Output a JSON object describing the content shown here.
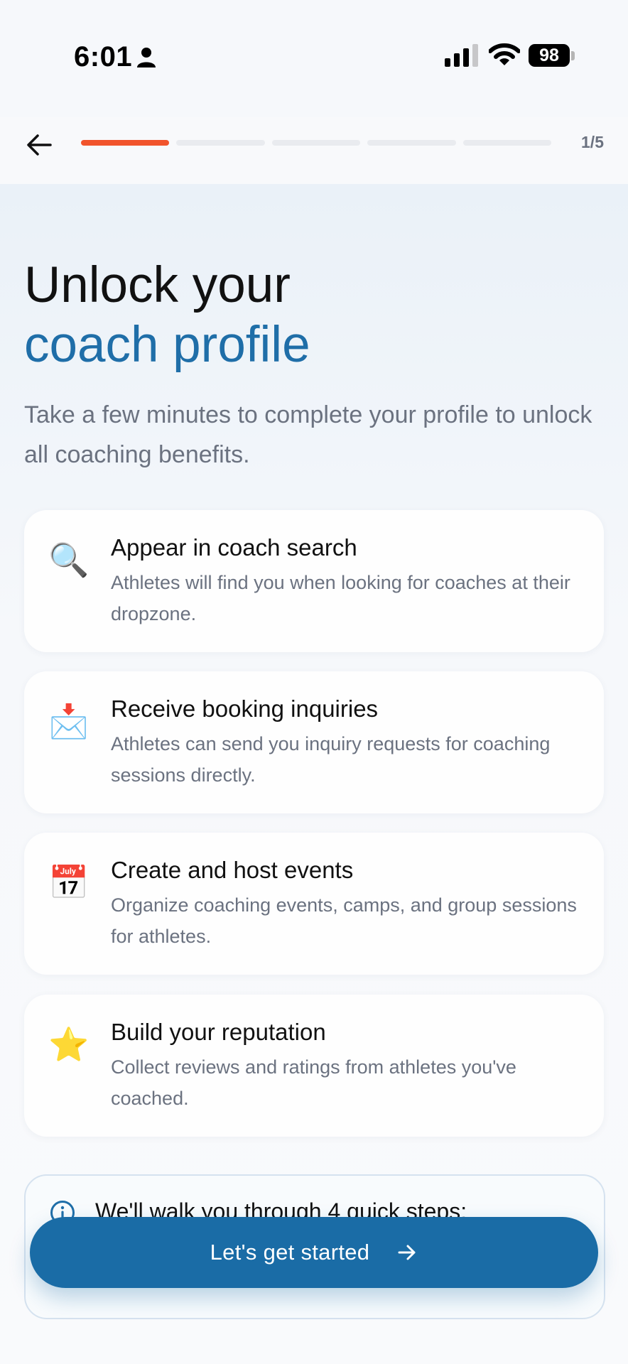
{
  "status_bar": {
    "time": "6:01",
    "battery": "98"
  },
  "header": {
    "step": "1/5",
    "progress": {
      "current": 1,
      "total": 5
    }
  },
  "hero": {
    "title_line1": "Unlock your",
    "title_line2": "coach profile",
    "subtitle": "Take a few minutes to complete your profile to unlock all coaching benefits.",
    "accent_color": "#1f6ea8"
  },
  "benefits": [
    {
      "icon": "magnifying-glass-icon",
      "glyph": "🔍",
      "title": "Appear in coach search",
      "description": "Athletes will find you when looking for coaches at their dropzone."
    },
    {
      "icon": "envelope-icon",
      "glyph": "📩",
      "title": "Receive booking inquiries",
      "description": "Athletes can send you inquiry requests for coaching sessions directly."
    },
    {
      "icon": "calendar-icon",
      "glyph": "📅",
      "title": "Create and host events",
      "description": "Organize coaching events, camps, and group sessions for athletes."
    },
    {
      "icon": "star-icon",
      "glyph": "⭐",
      "title": "Build your reputation",
      "description": "Collect reviews and ratings from athletes you've coached."
    }
  ],
  "info": {
    "text": "We'll walk you through 4 quick steps:"
  },
  "cta": {
    "label": "Let's get started",
    "color": "#1a6ca6"
  },
  "colors": {
    "progress_active": "#f1542c",
    "progress_inactive": "#e9ebef"
  }
}
